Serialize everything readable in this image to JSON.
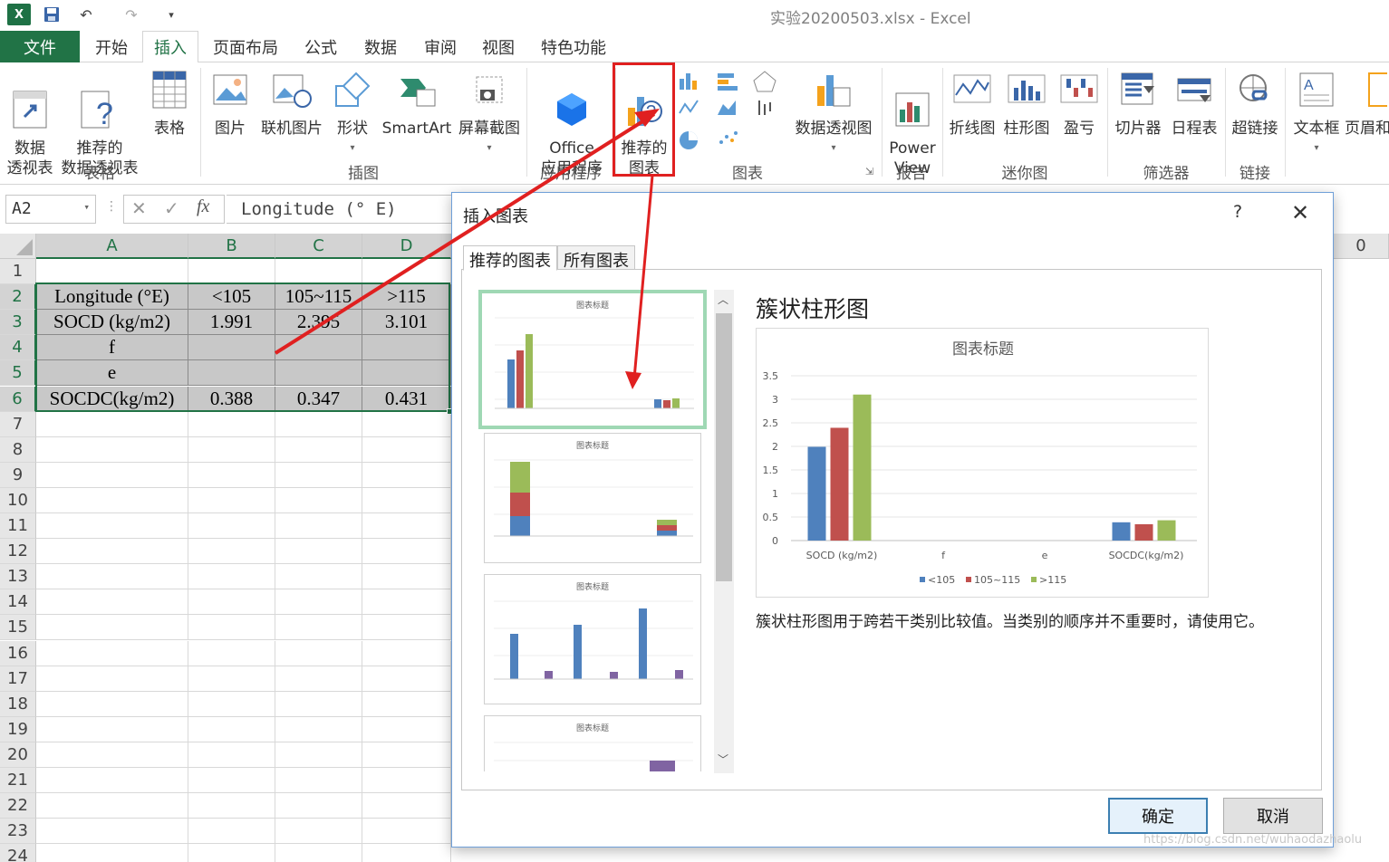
{
  "window": {
    "title": "实验20200503.xlsx - Excel"
  },
  "ribbon_tabs": [
    "文件",
    "开始",
    "插入",
    "页面布局",
    "公式",
    "数据",
    "审阅",
    "视图",
    "特色功能"
  ],
  "ribbon": {
    "buttons": {
      "pivot": "数据\n透视表",
      "rec_pivot": "推荐的\n数据透视表",
      "table": "表格",
      "picture": "图片",
      "online_pic": "联机图片",
      "shapes": "形状",
      "smartart": "SmartArt",
      "screenshot": "屏幕截图",
      "office_apps": "Office\n应用程序",
      "rec_charts": "推荐的\n图表",
      "pivot_chart": "数据透视图",
      "power_view": "Power\nView",
      "line": "折线图",
      "column": "柱形图",
      "winloss": "盈亏",
      "slicer": "切片器",
      "timeline": "日程表",
      "hyperlink": "超链接",
      "textbox": "文本框",
      "header": "页眉和"
    },
    "groups": {
      "tables": "表格",
      "illustrations": "插图",
      "apps": "应用程序",
      "charts": "图表",
      "reports": "报告",
      "sparklines": "迷你图",
      "filters": "筛选器",
      "links": "链接"
    }
  },
  "formula_bar": {
    "namebox": "A2",
    "fx": "fx",
    "content": "Longitude (° E)"
  },
  "sheet": {
    "columns": [
      "A",
      "B",
      "C",
      "D"
    ],
    "right_col_label": "0",
    "rows": [
      "1",
      "2",
      "3",
      "4",
      "5",
      "6",
      "7",
      "8",
      "9",
      "10",
      "11",
      "12",
      "13",
      "14",
      "15",
      "16",
      "17",
      "18",
      "19",
      "20",
      "21",
      "22",
      "23",
      "24"
    ],
    "cells": {
      "r2": [
        "Longitude (°E)",
        "<105",
        "105~115",
        ">115"
      ],
      "r3": [
        "SOCD (kg/m2)",
        "1.991",
        "2.395",
        "3.101"
      ],
      "r4": [
        "f",
        "",
        "",
        ""
      ],
      "r5": [
        "e",
        "",
        "",
        ""
      ],
      "r6": [
        "SOCDC(kg/m2)",
        "0.388",
        "0.347",
        "0.431"
      ]
    }
  },
  "dialog": {
    "title": "插入图表",
    "help": "?",
    "close": "✕",
    "tabs": [
      "推荐的图表",
      "所有图表"
    ],
    "chart_type_title": "簇状柱形图",
    "description": "簇状柱形图用于跨若干类别比较值。当类别的顺序并不重要时，请使用它。",
    "ok": "确定",
    "cancel": "取消",
    "thumb_title": "图表标题"
  },
  "colors": {
    "excel_green": "#217346",
    "s1": "#4f81bd",
    "s2": "#c0504d",
    "s3": "#9bbb59",
    "s4": "#8064a2",
    "highlight": "#e02020"
  },
  "chart_data": {
    "type": "bar",
    "title": "图表标题",
    "categories": [
      "SOCD (kg/m2)",
      "f",
      "e",
      "SOCDC(kg/m2)"
    ],
    "series": [
      {
        "name": "<105",
        "values": [
          1.991,
          0,
          0,
          0.388
        ]
      },
      {
        "name": "105~115",
        "values": [
          2.395,
          0,
          0,
          0.347
        ]
      },
      {
        "name": ">115",
        "values": [
          3.101,
          0,
          0,
          0.431
        ]
      }
    ],
    "yticks": [
      "0",
      "0.5",
      "1",
      "1.5",
      "2",
      "2.5",
      "3",
      "3.5"
    ],
    "ylim": [
      0,
      3.5
    ],
    "legend": "bottom",
    "grid": true
  },
  "watermark": "https://blog.csdn.net/wuhaodazhaolu"
}
